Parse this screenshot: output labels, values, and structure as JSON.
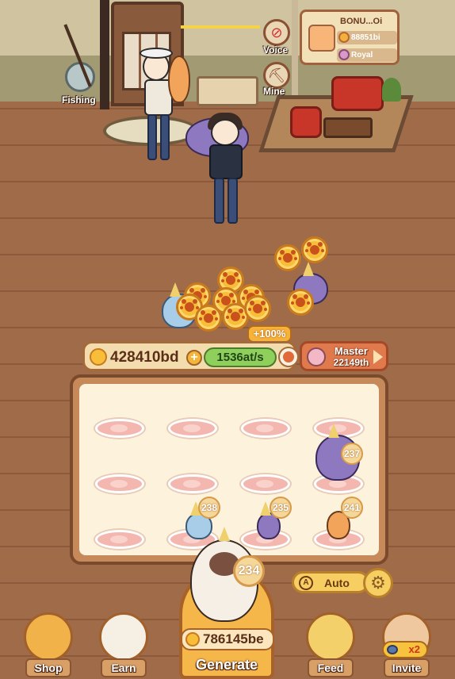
{
  "room": {
    "fishing_label": "Fishing",
    "voice_label": "Voice",
    "mine_label": "Mine"
  },
  "bonus_card": {
    "name": "BONU...Oi",
    "coins": "88851bi",
    "tier": "Royal"
  },
  "stats": {
    "balance": "428410bd",
    "rate": "1536at/s",
    "boost": "+100%",
    "rank_title": "Master",
    "rank_value": "22149th"
  },
  "board": {
    "levels": [
      "237",
      "238",
      "235",
      "241"
    ]
  },
  "auto": {
    "label": "Auto",
    "icon_text": "A"
  },
  "generator": {
    "level": "234",
    "price": "786145be",
    "label": "Generate"
  },
  "nav": {
    "shop": "Shop",
    "earn": "Earn",
    "feed": "Feed",
    "invite": "Invite",
    "invite_badge": "x2"
  },
  "icons": {
    "voice": "mute-icon",
    "mine": "pickaxe-icon",
    "settings": "gear-icon"
  }
}
